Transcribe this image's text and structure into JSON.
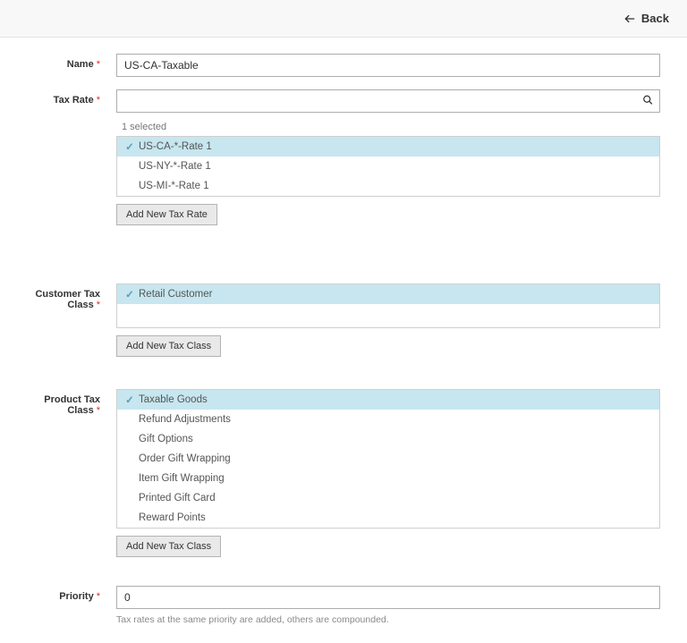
{
  "topbar": {
    "back_label": "Back"
  },
  "fields": {
    "name": {
      "label": "Name",
      "value": "US-CA-Taxable"
    },
    "tax_rate": {
      "label": "Tax Rate",
      "selected_count": "1 selected",
      "options": [
        {
          "label": "US-CA-*-Rate 1",
          "selected": true
        },
        {
          "label": "US-NY-*-Rate 1",
          "selected": false
        },
        {
          "label": "US-MI-*-Rate 1",
          "selected": false
        }
      ],
      "add_button": "Add New Tax Rate"
    },
    "customer_tax_class": {
      "label": "Customer Tax Class",
      "options": [
        {
          "label": "Retail Customer",
          "selected": true
        }
      ],
      "add_button": "Add New Tax Class"
    },
    "product_tax_class": {
      "label": "Product Tax Class",
      "options": [
        {
          "label": "Taxable Goods",
          "selected": true
        },
        {
          "label": "Refund Adjustments",
          "selected": false
        },
        {
          "label": "Gift Options",
          "selected": false
        },
        {
          "label": "Order Gift Wrapping",
          "selected": false
        },
        {
          "label": "Item Gift Wrapping",
          "selected": false
        },
        {
          "label": "Printed Gift Card",
          "selected": false
        },
        {
          "label": "Reward Points",
          "selected": false
        }
      ],
      "add_button": "Add New Tax Class"
    },
    "priority": {
      "label": "Priority",
      "value": "0",
      "helper": "Tax rates at the same priority are added, others are compounded."
    }
  }
}
